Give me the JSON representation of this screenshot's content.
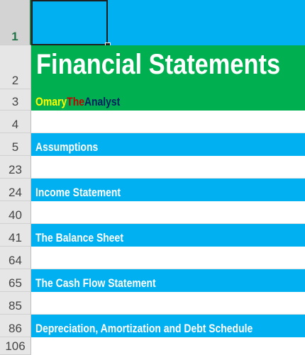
{
  "rows": {
    "r1": "1",
    "r2": "2",
    "r3": "3",
    "r4": "4",
    "r5": "5",
    "r23": "23",
    "r24": "24",
    "r40": "40",
    "r41": "41",
    "r64": "64",
    "r65": "65",
    "r85": "85",
    "r86": "86",
    "r106": "106"
  },
  "header": {
    "title": "Financial Statements",
    "brand_part1": "Omary",
    "brand_part2": "The",
    "brand_part3": "Analyst"
  },
  "sections": {
    "assumptions": "Assumptions",
    "income": "Income Statement",
    "balance": "The Balance Sheet",
    "cashflow": "The Cash Flow Statement",
    "depreciation": "Depreciation, Amortization and Debt Schedule"
  },
  "colors": {
    "blue": "#00b0f0",
    "green": "#00b050",
    "brand_the": "#c00000",
    "brand_analyst": "#002060",
    "brand_omary": "#ffff00"
  }
}
